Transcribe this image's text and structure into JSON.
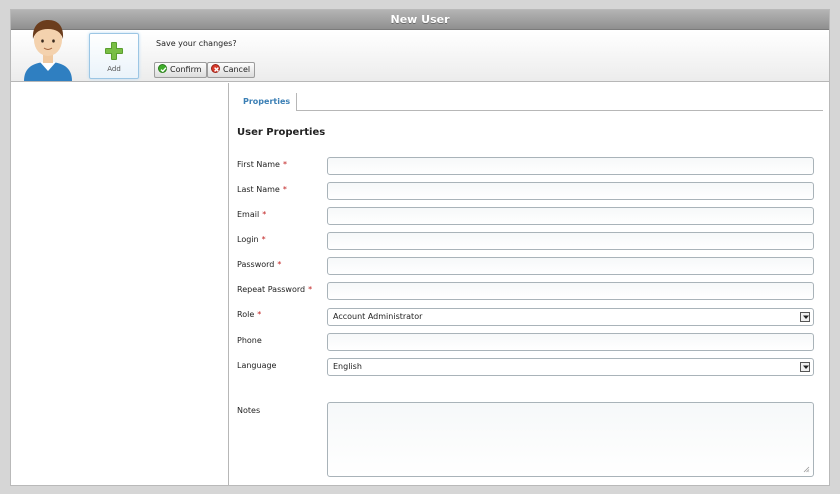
{
  "window": {
    "title": "New User"
  },
  "toolbar": {
    "add_label": "Add",
    "question": "Save your changes?",
    "confirm_label": "Confirm",
    "cancel_label": "Cancel"
  },
  "tabs": [
    {
      "label": "Properties"
    }
  ],
  "form": {
    "section_title": "User Properties",
    "required_mark": "*",
    "fields": {
      "first_name": {
        "label": "First Name",
        "value": ""
      },
      "last_name": {
        "label": "Last Name",
        "value": ""
      },
      "email": {
        "label": "Email",
        "value": ""
      },
      "login": {
        "label": "Login",
        "value": ""
      },
      "password": {
        "label": "Password",
        "value": ""
      },
      "repeat_password": {
        "label": "Repeat Password",
        "value": ""
      },
      "role": {
        "label": "Role",
        "selected": "Account Administrator"
      },
      "phone": {
        "label": "Phone",
        "value": ""
      },
      "language": {
        "label": "Language",
        "selected": "English"
      },
      "notes": {
        "label": "Notes",
        "value": ""
      }
    }
  },
  "icons": {
    "avatar": "user-avatar-icon",
    "add": "plus-icon",
    "confirm": "check-circle-icon",
    "cancel": "x-circle-icon",
    "dropdown": "chevron-down-icon",
    "resize": "resize-grip-icon"
  },
  "colors": {
    "title_bar": "#9f9f9f",
    "tab_text": "#3b7fb5",
    "required": "#c02020",
    "confirm": "#3fae2a",
    "cancel": "#d93a2a",
    "add_plus": "#5a9e2f"
  }
}
